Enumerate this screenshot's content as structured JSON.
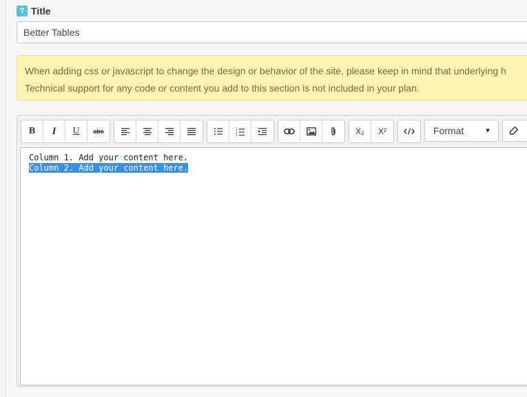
{
  "field": {
    "help_icon": "?",
    "title_label": "Title",
    "title_value": "Better Tables"
  },
  "warning": {
    "line1": "When adding css or javascript to change the design or behavior of the site, please keep in mind that underlying h",
    "line2": "Technical support for any code or content you add to this section is not included in your plan."
  },
  "toolbar": {
    "bold_label": "B",
    "italic_label": "I",
    "underline_label": "U",
    "strike_label": "abc",
    "subscript_label": "X₂",
    "superscript_label": "X²",
    "format_label": "Format",
    "format_caret": "▼"
  },
  "editor": {
    "line1": "Column 1. Add your content here.",
    "line2": "Column 2. Add your content here."
  },
  "colors": {
    "help_badge": "#5bc0de",
    "warning_bg": "#fdf3b3",
    "selection": "#3a8ee6"
  },
  "icons": [
    "bold-icon",
    "italic-icon",
    "underline-icon",
    "strikethrough-icon",
    "align-left-icon",
    "align-center-icon",
    "align-right-icon",
    "align-justify-icon",
    "bullet-list-icon",
    "numbered-list-icon",
    "indent-icon",
    "link-icon",
    "image-icon",
    "attachment-icon",
    "subscript-icon",
    "superscript-icon",
    "code-icon",
    "eraser-icon"
  ]
}
